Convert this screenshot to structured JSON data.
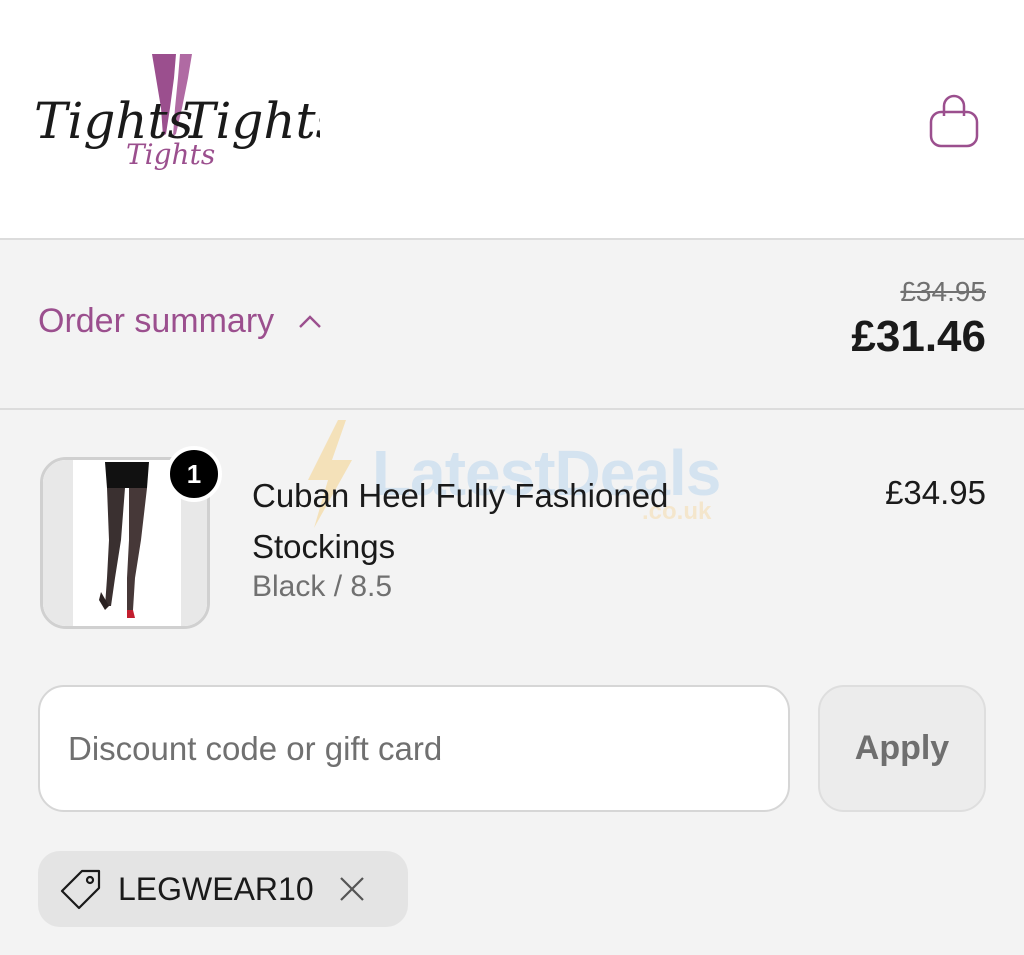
{
  "header": {
    "logo_words": [
      "Tights",
      "Tights",
      "Tights"
    ],
    "cart_icon": "shopping-bag-icon"
  },
  "summary": {
    "label": "Order summary",
    "toggle_icon": "chevron-up-icon",
    "original_total": "£34.95",
    "discounted_total": "£31.46"
  },
  "product": {
    "quantity": "1",
    "name": "Cuban Heel Fully Fashioned Stockings",
    "variant": "Black / 8.5",
    "price": "£34.95"
  },
  "watermark": {
    "text": "LatestDeals",
    "sub": ".co.uk"
  },
  "discount": {
    "placeholder": "Discount code or gift card",
    "value": "",
    "apply_label": "Apply"
  },
  "applied_code": {
    "icon": "tag-icon",
    "code": "LEGWEAR10",
    "remove_icon": "close-icon"
  },
  "colors": {
    "accent": "#9b4f8e",
    "background": "#f3f3f3",
    "text": "#1a1a1a",
    "muted": "#707070"
  }
}
